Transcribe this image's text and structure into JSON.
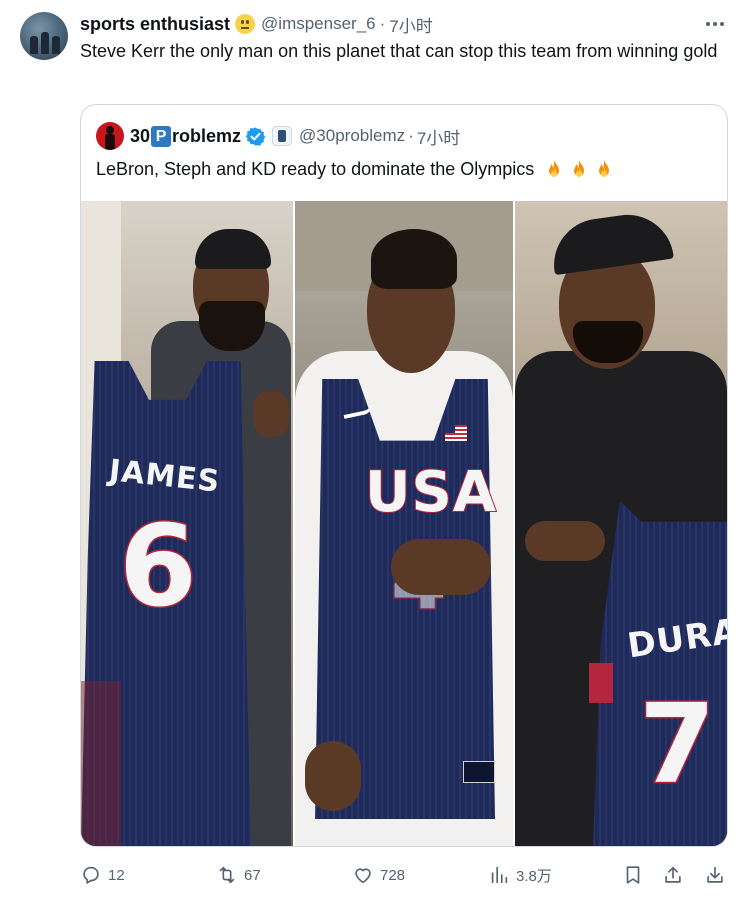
{
  "tweet": {
    "display_name": "sports enthusiast",
    "name_emoji": "neutral-face-emoji",
    "handle": "@imspenser_6",
    "separator": "·",
    "time": "7小时",
    "text": "Steve Kerr the only man on this planet that can stop this team from winning gold"
  },
  "quote": {
    "name_prefix": "30",
    "name_letter": "P",
    "name_suffix": "roblemz",
    "handle": "@30problemz",
    "separator": "·",
    "time": "7小时",
    "text": "LeBron, Steph and KD ready to dominate the Olympics",
    "emojis": [
      "fire-emoji",
      "fire-emoji",
      "fire-emoji"
    ],
    "media": {
      "left": {
        "jersey_name": "JAMES",
        "jersey_number": "6"
      },
      "middle": {
        "jersey_text": "USA",
        "jersey_number": "4"
      },
      "right": {
        "jersey_name": "DURANT",
        "jersey_number": "7"
      }
    }
  },
  "actions": {
    "replies": "12",
    "retweets": "67",
    "likes": "728",
    "views": "3.8万"
  },
  "colors": {
    "text_primary": "#0f1419",
    "text_secondary": "#536471",
    "border": "#cfd9de",
    "verified_blue": "#1d9bf0",
    "jersey_navy": "#1f2a5c",
    "jersey_red": "#b3263c"
  }
}
